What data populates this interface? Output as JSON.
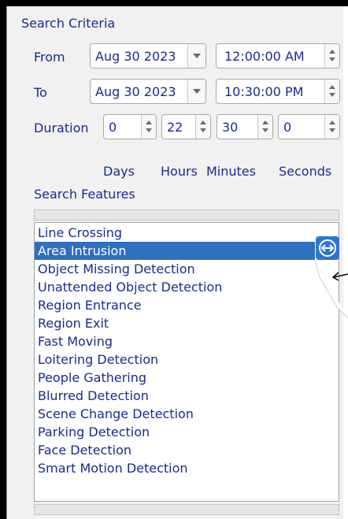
{
  "criteria": {
    "title": "Search Criteria",
    "from": {
      "label": "From",
      "date": "Aug 30 2023",
      "time": "12:00:00 AM"
    },
    "to": {
      "label": "To",
      "date": "Aug 30 2023",
      "time": "10:30:00 PM"
    },
    "duration": {
      "label": "Duration",
      "values": [
        "0",
        "22",
        "30",
        "0"
      ],
      "units": [
        "Days",
        "Hours",
        "Minutes",
        "Seconds"
      ]
    }
  },
  "features": {
    "title": "Search Features",
    "items": [
      "Line Crossing",
      "Area Intrusion",
      "Object Missing Detection",
      "Unattended Object Detection",
      "Region Entrance",
      "Region Exit",
      "Fast Moving",
      "Loitering Detection",
      "People Gathering",
      "Blurred Detection",
      "Scene Change Detection",
      "Parking Detection",
      "Face Detection",
      "Smart Motion Detection"
    ],
    "selected_index": 1
  },
  "icons": {
    "move": "move-horizontal-icon",
    "spinner": "spin-up-down-icon",
    "dropdown": "chevron-down-icon",
    "pointer": "arrow-pointer-icon"
  },
  "colors": {
    "text": "#1a2b8c",
    "selection": "#2e6fbf",
    "move_icon": "#2e76d0"
  }
}
